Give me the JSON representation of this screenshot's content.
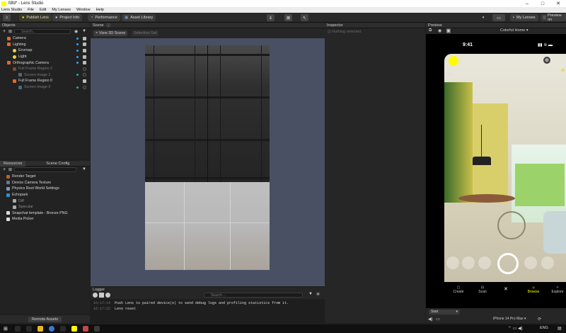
{
  "window": {
    "title": "fdfd* - Lens Studio"
  },
  "menu": [
    "Lens Studio",
    "File",
    "Edit",
    "My Lenses",
    "Window",
    "Help"
  ],
  "toolbar": {
    "publish": "Publish Lens",
    "project_info": "Project Info",
    "performance": "Performance",
    "asset_library": "Asset Library",
    "my_lenses": "My Lenses",
    "preview_on": "Preview on"
  },
  "objects": {
    "title": "Objects",
    "search_placeholder": "Search...",
    "items": [
      {
        "label": "Camera",
        "dim": false
      },
      {
        "label": "Lighting",
        "dim": false
      },
      {
        "label": "Envmap",
        "dim": false
      },
      {
        "label": "Light",
        "dim": false
      },
      {
        "label": "Orthographic Camera",
        "dim": false
      },
      {
        "label": "Full Frame Region 2",
        "dim": true
      },
      {
        "label": "Screen Image 2",
        "dim": true
      },
      {
        "label": "Full Frame Region 0",
        "dim": false
      },
      {
        "label": "Screen Image 0",
        "dim": true
      }
    ]
  },
  "resources": {
    "tab1": "Resources",
    "tab2": "Scene Config",
    "items": [
      "Render Target",
      "Device Camera Texture",
      "Physics Root World Settings",
      "Echopark",
      "Diff",
      "Specular",
      "Snapchat template - Bronze PNG",
      "Media Picker"
    ],
    "remote_assets": "Remote Assets"
  },
  "scene": {
    "title": "Scene",
    "tab_3d": "View 3D Scene",
    "tab_selection": "Selection Set"
  },
  "inspector": {
    "title": "Inspector",
    "nothing_selected": "Nothing selected"
  },
  "preview": {
    "title": "Preview",
    "env": "Colorful Home",
    "time": "9:41",
    "carousel": [
      "Create",
      "Scan",
      "Browse",
      "Explore"
    ],
    "start": "Start",
    "device": "iPhone 14 Pro Max"
  },
  "logger": {
    "title": "Logger",
    "search_placeholder": "Search...",
    "lines": [
      {
        "time": "16:17:14",
        "text": "Push Lens to paired device(s) to send debug logs and profiling statistics from it."
      },
      {
        "time": "16:17:22",
        "text": "Lens reset"
      }
    ]
  },
  "taskbar": {
    "lang": "ENG"
  },
  "colors": {
    "accent": "#fffc00",
    "panel": "#222222",
    "scene_bg": "#495063"
  }
}
